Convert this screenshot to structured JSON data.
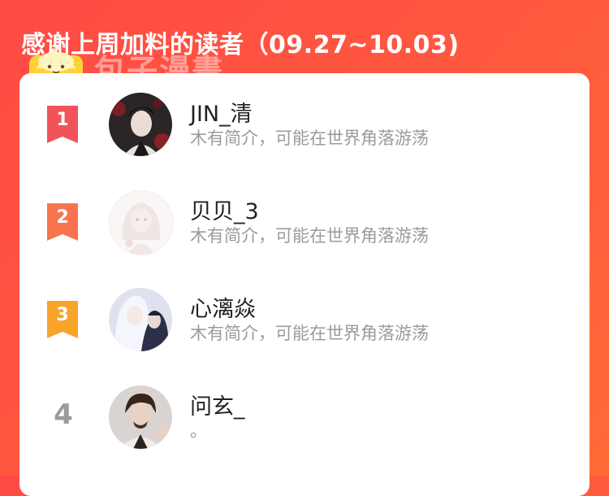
{
  "header": {
    "title": "感谢上周加料的读者（09.27~10.03)"
  },
  "watermark": {
    "text": "包子漫畫"
  },
  "colors": {
    "background_start": "#ff4a45",
    "background_end": "#ff6a36",
    "rank1": "#f0545a",
    "rank2": "#f7744f",
    "rank3": "#f8a42a",
    "rank_plain": "#9a9a9a"
  },
  "readers": [
    {
      "rank": "1",
      "name": "JIN_清",
      "bio": "木有简介，可能在世界角落游荡",
      "avatar": "avatar-dark-haired-man"
    },
    {
      "rank": "2",
      "name": "贝贝_3",
      "bio": "木有简介，可能在世界角落游荡",
      "avatar": "avatar-faded-sketch-girl"
    },
    {
      "rank": "3",
      "name": "心漓焱",
      "bio": "木有简介，可能在世界角落游荡",
      "avatar": "avatar-white-haired-pair"
    },
    {
      "rank": "4",
      "name": "问玄_",
      "bio": "。",
      "avatar": "avatar-bearded-man"
    }
  ]
}
